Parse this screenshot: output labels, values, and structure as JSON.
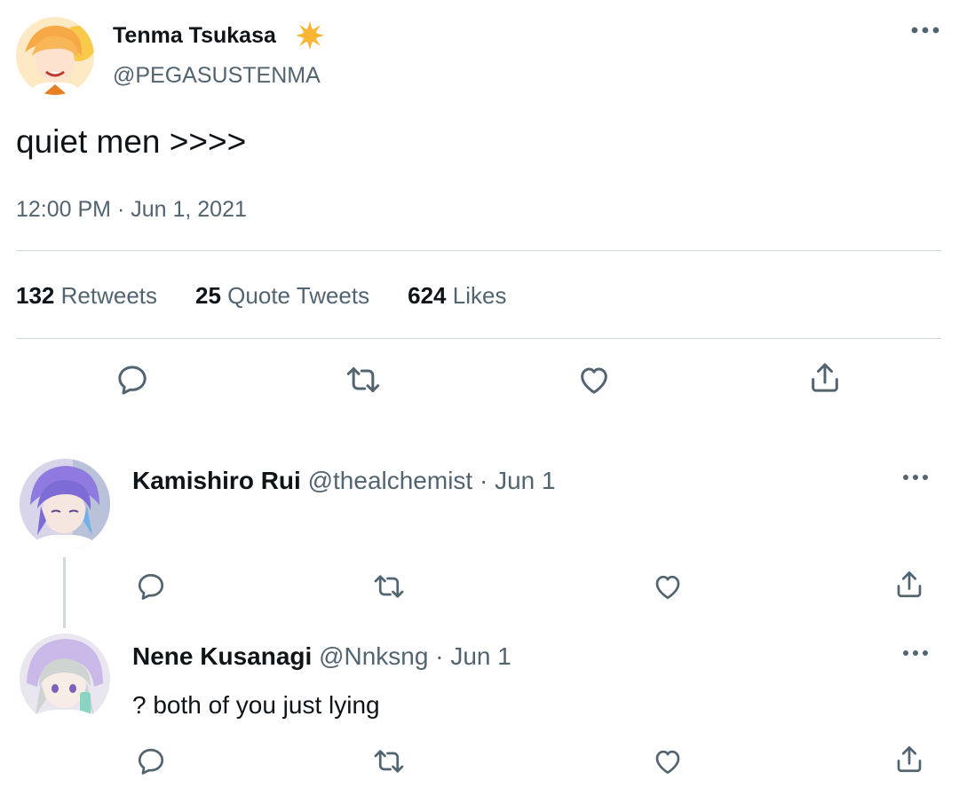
{
  "tweet": {
    "author_name": "Tenma Tsukasa",
    "author_handle": "@PEGASUSTENMA",
    "badge_icon": "sun-badge-icon",
    "text": "quiet men >>>>",
    "timestamp": "12:00 PM · Jun 1, 2021",
    "stats": {
      "retweets_count": "132",
      "retweets_label": "Retweets",
      "quotes_count": "25",
      "quotes_label": "Quote Tweets",
      "likes_count": "624",
      "likes_label": "Likes"
    },
    "actions": [
      "reply-icon",
      "retweet-icon",
      "like-icon",
      "share-icon"
    ]
  },
  "replies": [
    {
      "name": "Kamishiro Rui",
      "handle": "@thealchemist",
      "date": "· Jun 1",
      "text": "",
      "avatar_color": "#8f7be0"
    },
    {
      "name": "Nene Kusanagi",
      "handle": "@Nnksng",
      "date": "· Jun 1",
      "text": "? both of you just lying",
      "avatar_color": "#c9c7d8"
    }
  ],
  "colors": {
    "text_primary": "#0f1419",
    "text_secondary": "#536471",
    "divider": "#cfd9de",
    "badge": "#f7b531"
  }
}
